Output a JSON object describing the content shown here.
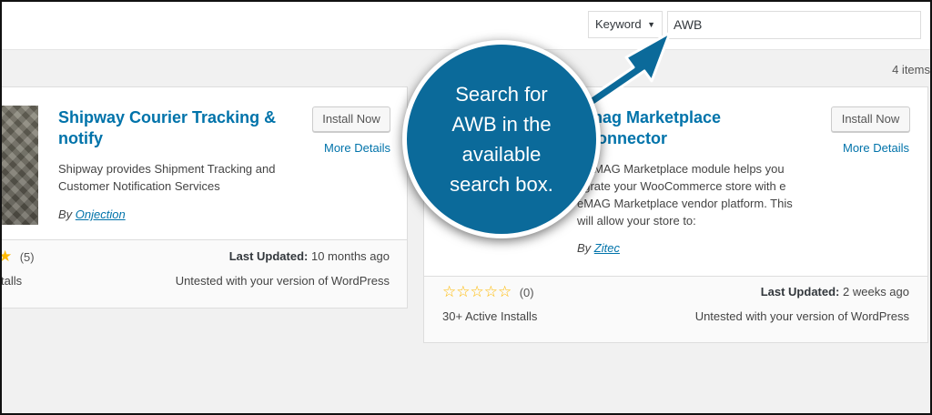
{
  "filter": {
    "label": "Keyword",
    "caret": "▼"
  },
  "search": {
    "value": "AWB"
  },
  "results": {
    "count": "4 items"
  },
  "cards": [
    {
      "name": "Shipway Courier Tracking & notify",
      "install_label": "Install Now",
      "more_details": "More Details",
      "description": "Shipway provides Shipment Tracking and Customer Notification Services",
      "author_prefix": "By",
      "author": "Onjection",
      "rating_count": "(5)",
      "installs": "talls",
      "last_updated_label": "Last Updated:",
      "last_updated_value": "10 months ago",
      "compat": "Untested with your version of WordPress"
    },
    {
      "name": "mag Marketplace connector",
      "install_label": "Install Now",
      "more_details": "More Details",
      "description": "e eMAG Marketplace module helps you egrate your WooCommerce store with e eMAG Marketplace vendor platform. This will allow your store to:",
      "author_prefix": "By",
      "author": "Zitec",
      "rating_count": "(0)",
      "installs": "30+ Active Installs",
      "last_updated_label": "Last Updated:",
      "last_updated_value": "2 weeks ago",
      "compat": "Untested with your version of WordPress"
    }
  ],
  "callout": {
    "text": "Search for AWB in the available search box."
  },
  "colors": {
    "link": "#0073aa",
    "callout": "#0b6a9a",
    "star": "#ffb900"
  },
  "icons": {
    "star_filled": "★",
    "star_empty": "☆"
  }
}
